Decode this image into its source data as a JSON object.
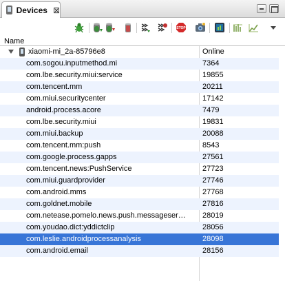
{
  "tab": {
    "title": "Devices",
    "close_glyph": "⊠",
    "icon": "device-icon"
  },
  "window_controls": [
    "minimize",
    "maximize"
  ],
  "toolbar": {
    "buttons": [
      {
        "name": "debug-process-button",
        "icon": "bug-icon",
        "color": "#3fa33a"
      },
      {
        "name": "update-heap-button",
        "icon": "heap-icon",
        "color": "#3c8c3c"
      },
      {
        "name": "dump-hprof-button",
        "icon": "hprof-icon",
        "color": "#c03030"
      },
      {
        "name": "cause-gc-button",
        "icon": "trash-icon",
        "color": "#555555"
      },
      {
        "name": "update-threads-button",
        "icon": "threads-icon",
        "color": "#333333"
      },
      {
        "name": "start-method-profiling-button",
        "icon": "method-profiling-icon",
        "color": "#c03030"
      },
      {
        "name": "stop-process-button",
        "icon": "stop-icon",
        "color": "#d42a2a"
      },
      {
        "name": "screen-capture-button",
        "icon": "camera-icon",
        "color": "#4a74b0"
      },
      {
        "name": "dump-view-hierarchy-button",
        "icon": "view-hierarchy-icon",
        "color": "#2a6a9a"
      },
      {
        "name": "systrace-button",
        "icon": "systrace-icon",
        "color": "#7aa04a"
      },
      {
        "name": "opengl-trace-button",
        "icon": "opengl-trace-icon",
        "color": "#7aa04a"
      },
      {
        "name": "view-menu-button",
        "icon": "chevron-down-icon",
        "color": "#444444"
      }
    ]
  },
  "columns": {
    "name": "Name",
    "pid": ""
  },
  "device": {
    "name": "xiaomi-mi_2a-85796e8",
    "status": "Online"
  },
  "processes": [
    {
      "name": "com.sogou.inputmethod.mi",
      "pid": "7364"
    },
    {
      "name": "com.lbe.security.miui:service",
      "pid": "19855"
    },
    {
      "name": "com.tencent.mm",
      "pid": "20211"
    },
    {
      "name": "com.miui.securitycenter",
      "pid": "17142"
    },
    {
      "name": "android.process.acore",
      "pid": "7479"
    },
    {
      "name": "com.lbe.security.miui",
      "pid": "19831"
    },
    {
      "name": "com.miui.backup",
      "pid": "20088"
    },
    {
      "name": "com.tencent.mm:push",
      "pid": "8543"
    },
    {
      "name": "com.google.process.gapps",
      "pid": "27561"
    },
    {
      "name": "com.tencent.news:PushService",
      "pid": "27723"
    },
    {
      "name": "com.miui.guardprovider",
      "pid": "27746"
    },
    {
      "name": "com.android.mms",
      "pid": "27768"
    },
    {
      "name": "com.goldnet.mobile",
      "pid": "27816"
    },
    {
      "name": "com.netease.pomelo.news.push.messageser…",
      "pid": "28019"
    },
    {
      "name": "com.youdao.dict:yddictclip",
      "pid": "28056"
    },
    {
      "name": "com.leslie.androidprocessanalysis",
      "pid": "28098",
      "selected": true
    },
    {
      "name": "com.android.email",
      "pid": "28156"
    }
  ],
  "colors": {
    "selection": "#3875d7",
    "alt_row": "#edf3fe"
  }
}
